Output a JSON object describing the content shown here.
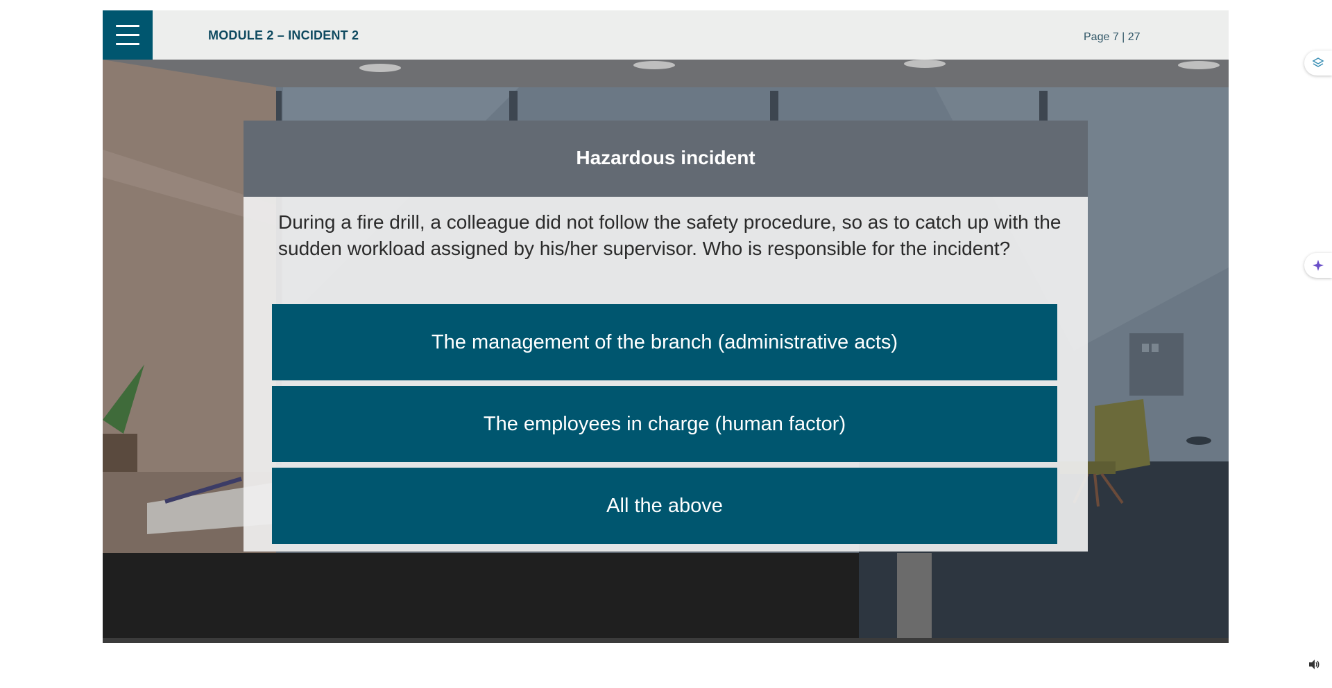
{
  "header": {
    "module_title": "MODULE 2 – INCIDENT 2",
    "page_indicator": "Page 7 | 27",
    "menu_icon": "hamburger-menu-icon"
  },
  "modal": {
    "title": "Hazardous incident",
    "question": "During a fire drill, a colleague did not follow the safety procedure, so as to catch up with the sudden workload assigned by his/her supervisor. Who is responsible for the incident?",
    "options": [
      {
        "label": "The management of the branch (administrative acts)"
      },
      {
        "label": "The employees in charge (human factor)"
      },
      {
        "label": "All the above"
      }
    ]
  },
  "side_widgets": {
    "top_icon": "layers-icon",
    "middle_icon": "sparkle-icon"
  },
  "footer": {
    "audio_icon": "speaker-icon"
  },
  "colors": {
    "accent": "#00566f",
    "header_bg": "#edeeed",
    "modal_header_bg": "#636a73",
    "title_text": "#0f4a60"
  }
}
